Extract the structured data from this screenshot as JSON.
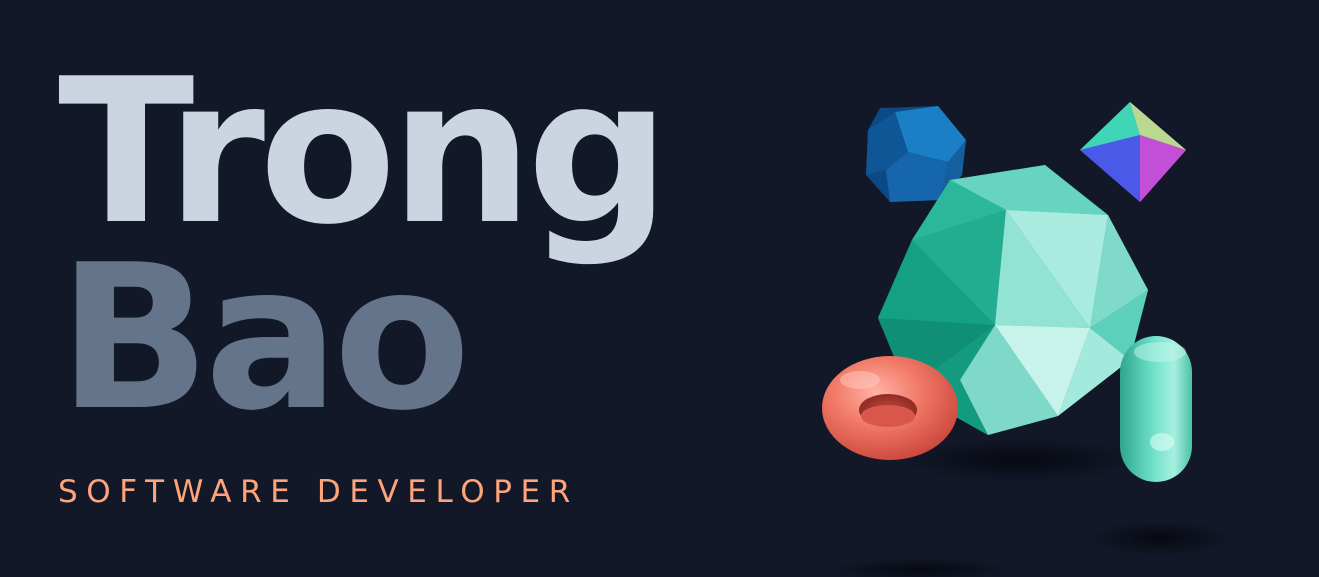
{
  "hero": {
    "name_first": "Trong",
    "name_last": "Bao",
    "role": "SOFTWARE DEVELOPER"
  },
  "colors": {
    "background": "#121828",
    "name_first": "#cbd5e1",
    "name_last": "#64748b",
    "role": "#fda47b",
    "accent_teal": "#5fd3bc",
    "accent_coral": "#f07a68",
    "accent_blue": "#1b78c4",
    "accent_violet": "#6f4bd8"
  },
  "scene": {
    "objects": [
      "icosahedron",
      "dodecahedron",
      "octahedron",
      "torus",
      "capsule"
    ]
  }
}
